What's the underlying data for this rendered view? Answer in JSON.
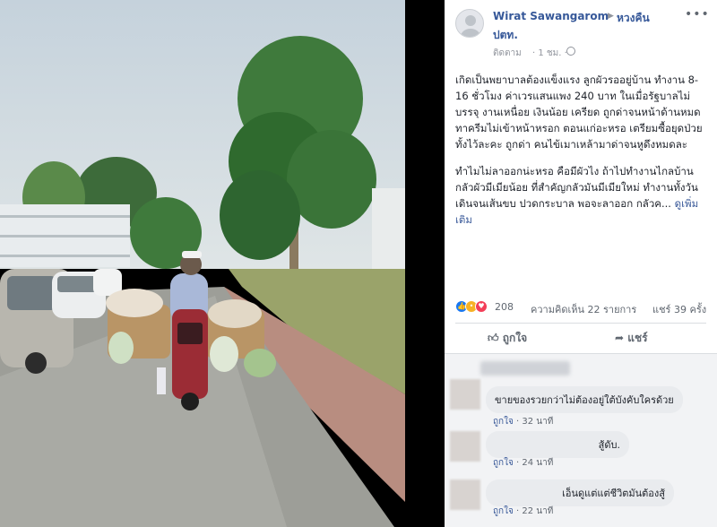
{
  "post": {
    "author": "Wirat Sawangarom",
    "group_line1": "หวงคืน",
    "group_line2": "ปตท.",
    "follow": "ติดตาม",
    "time": "· 1 ชม. ·",
    "body_p1": "เกิดเป็นพยาบาลต้องแข็งแรง ลูกผัวรออยู่บ้าน ทำงาน 8-16 ชั่วโมง ค่าเวรแสนแพง 240 บาท ในเมื่อรัฐบาลไม่บรรจุ งานเหนื่อย เงินน้อย เครียด ถูกด่าจนหน้าด้านหมด ทาครีมไม่เข้าหน้าหรอก ตอนแก่อะหรอ เตรียมซื้อยุดป่วยทั้งไว้ละคะ ถูกด่า คนไข้เมาเหล้ามาด่าจนหูดึงหมดละ",
    "body_p2": "ทำไมไม่ลาออกน่ะหรอ คือมีผัวไง ถ้าไปทำงานไกลบ้านกลัวผัวมีเมียน้อย ที่สำคัญกลัวมันมีเมียใหม่ ทำงานทั้งวัน เดินจนเส้นขบ ปวดกระบาล พอจะลาออก กลัวค... ",
    "see_more": "ดูเพิ่มเติม",
    "reaction_count": "208",
    "comments_count": "ความคิดเห็น 22 รายการ",
    "shares_count": "แชร์ 39 ครั้ง",
    "like_label": "ถูกใจ",
    "share_label": "แชร์"
  },
  "comments": [
    {
      "text": "ขายของรวยกว่าไม่ต้องอยู่ใต้บังคับใครด้วย",
      "like": "ถูกใจ",
      "time": "· 32 นาที"
    },
    {
      "text": "สู้ดับ.",
      "like": "ถูกใจ",
      "time": "· 24 นาที"
    },
    {
      "text": "เอ็นดูแต่แต่ชีวิตมันต้องสู้",
      "like": "ถูกใจ",
      "time": "· 22 นาที"
    }
  ],
  "colors": {
    "link": "#365899",
    "muted": "#90949c",
    "like": "#1877f2"
  },
  "icons": [
    "globe-icon",
    "more-icon",
    "like-reaction-icon",
    "wow-reaction-icon",
    "love-reaction-icon",
    "thumbs-up-icon",
    "share-arrow-icon"
  ]
}
